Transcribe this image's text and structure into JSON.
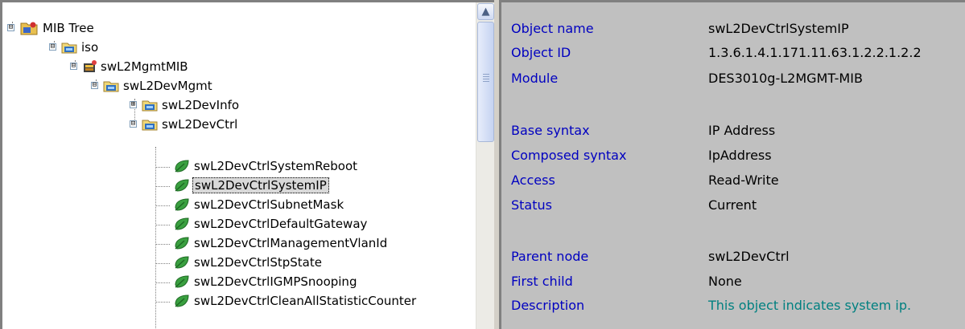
{
  "tree": {
    "nodes": [
      {
        "label": "MIB Tree",
        "icon": "mib-tree-root-icon",
        "toggle": "⊟"
      },
      {
        "label": "iso",
        "icon": "folder-node-icon",
        "toggle": "⊟"
      },
      {
        "label": "swL2MgmtMIB",
        "icon": "module-node-icon",
        "toggle": "⊟"
      },
      {
        "label": "swL2DevMgmt",
        "icon": "folder-node-icon",
        "toggle": "⊟"
      },
      {
        "label": "swL2DevInfo",
        "icon": "folder-node-icon",
        "toggle": "⊞"
      },
      {
        "label": "swL2DevCtrl",
        "icon": "folder-node-icon",
        "toggle": "⊟"
      },
      {
        "label": "swL2DevCtrlSystemReboot",
        "icon": "leaf-node-icon"
      },
      {
        "label": "swL2DevCtrlSystemIP",
        "icon": "leaf-node-icon",
        "selected": true
      },
      {
        "label": "swL2DevCtrlSubnetMask",
        "icon": "leaf-node-icon"
      },
      {
        "label": "swL2DevCtrlDefaultGateway",
        "icon": "leaf-node-icon"
      },
      {
        "label": "swL2DevCtrlManagementVlanId",
        "icon": "leaf-node-icon"
      },
      {
        "label": "swL2DevCtrlStpState",
        "icon": "leaf-node-icon"
      },
      {
        "label": "swL2DevCtrlIGMPSnooping",
        "icon": "leaf-node-icon"
      },
      {
        "label": "swL2DevCtrlCleanAllStatisticCounter",
        "icon": "leaf-node-icon"
      }
    ],
    "scroll_up_glyph": "▲"
  },
  "properties": {
    "object_name": {
      "label": "Object name",
      "value": "swL2DevCtrlSystemIP"
    },
    "object_id": {
      "label": "Object ID",
      "value": "1.3.6.1.4.1.171.11.63.1.2.2.1.2.2"
    },
    "module": {
      "label": "Module",
      "value": "DES3010g-L2MGMT-MIB"
    },
    "base_syntax": {
      "label": "Base syntax",
      "value": "IP Address"
    },
    "composed_syntax": {
      "label": "Composed syntax",
      "value": "IpAddress"
    },
    "access": {
      "label": "Access",
      "value": "Read-Write"
    },
    "status": {
      "label": "Status",
      "value": "Current"
    },
    "parent_node": {
      "label": "Parent node",
      "value": "swL2DevCtrl"
    },
    "first_child": {
      "label": "First child",
      "value": "None"
    },
    "description": {
      "label": "Description",
      "value": "This object indicates system ip."
    }
  },
  "colors": {
    "property_label": "#0000c0",
    "description_value": "#008080",
    "details_background": "#c0c0c0",
    "tree_background": "#ffffff"
  }
}
